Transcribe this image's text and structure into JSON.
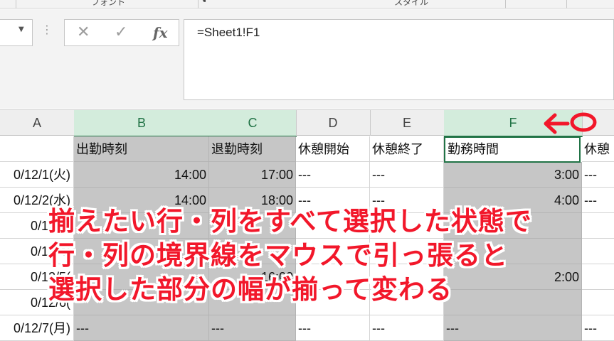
{
  "ribbon": {
    "groups": [
      "フォント",
      "スタイル"
    ]
  },
  "formula_bar": {
    "namebox_value": "",
    "cancel_icon": "✕",
    "enter_icon": "✓",
    "fx_label": "fx",
    "formula": "=Sheet1!F1"
  },
  "columns": [
    {
      "key": "A",
      "selected": false
    },
    {
      "key": "B",
      "selected": true
    },
    {
      "key": "C",
      "selected": true
    },
    {
      "key": "D",
      "selected": false
    },
    {
      "key": "E",
      "selected": false
    },
    {
      "key": "F",
      "selected": true
    }
  ],
  "rows": [
    {
      "a": "",
      "b": "出勤時刻",
      "c": "退勤時刻",
      "d": "休憩開始",
      "e": "休憩終了",
      "f": "勤務時間",
      "g": "休憩"
    },
    {
      "a": "0/12/1(火)",
      "b": "14:00",
      "c": "17:00",
      "d": "---",
      "e": "---",
      "f": "3:00",
      "g": "---"
    },
    {
      "a": "0/12/2(水)",
      "b": "14:00",
      "c": "18:00",
      "d": "---",
      "e": "---",
      "f": "4:00",
      "g": "---"
    },
    {
      "a": "0/12/3(",
      "b": "",
      "c": "",
      "d": "",
      "e": "",
      "f": "",
      "g": ""
    },
    {
      "a": "0/12/4(",
      "b": "",
      "c": "",
      "d": "",
      "e": "",
      "f": "",
      "g": ""
    },
    {
      "a": "0/12/5(",
      "b": "",
      "c": "16:00",
      "d": "",
      "e": "",
      "f": "2:00",
      "g": ""
    },
    {
      "a": "0/12/6(",
      "b": "",
      "c": "",
      "d": "",
      "e": "",
      "f": "",
      "g": ""
    },
    {
      "a": "0/12/7(月)",
      "b": "---",
      "c": "---",
      "d": "---",
      "e": "---",
      "f": "---",
      "g": "---"
    }
  ],
  "annotation": {
    "line1": "揃えたい行・列をすべて選択した状態で",
    "line2": "行・列の境界線をマウスで引っ張ると",
    "line3": "選択した部分の幅が揃って変わる",
    "color": "#f2172a"
  },
  "colors": {
    "selection_header": "#d3ecdc",
    "selection_accent": "#217346",
    "selected_cells": "#c6c6c6"
  }
}
